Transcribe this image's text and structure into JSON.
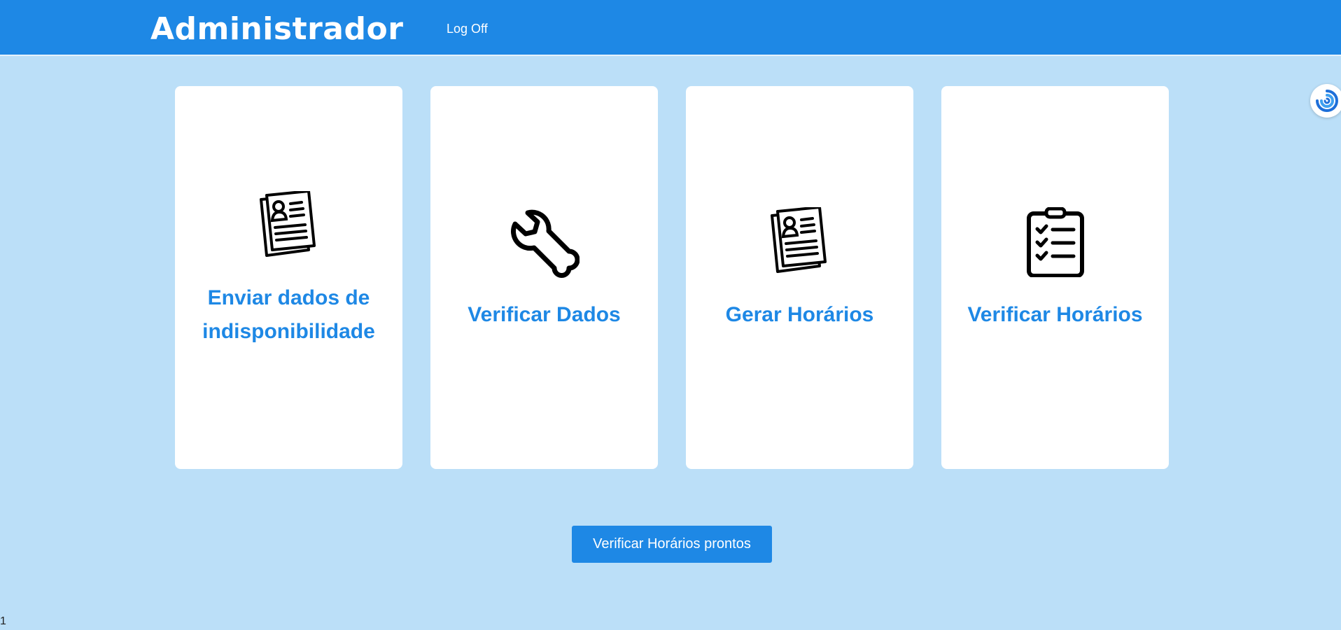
{
  "header": {
    "title": "Administrador",
    "logoff_label": "Log Off",
    "background_color": "#1e88e5"
  },
  "cards": [
    {
      "label": "Enviar dados de indisponibilidade",
      "icon": "resume-documents-icon"
    },
    {
      "label": "Verificar Dados",
      "icon": "wrench-icon"
    },
    {
      "label": "Gerar Horários",
      "icon": "resume-documents-icon"
    },
    {
      "label": "Verificar Horários",
      "icon": "checklist-clipboard-icon"
    }
  ],
  "actions": {
    "ready_schedules_label": "Verificar Horários prontos"
  },
  "side_widget": {
    "icon": "swirl-icon"
  },
  "footer": {
    "page_number": "1"
  },
  "colors": {
    "accent": "#1e88e5",
    "page_background": "#bbdff8",
    "card_background": "#ffffff"
  }
}
